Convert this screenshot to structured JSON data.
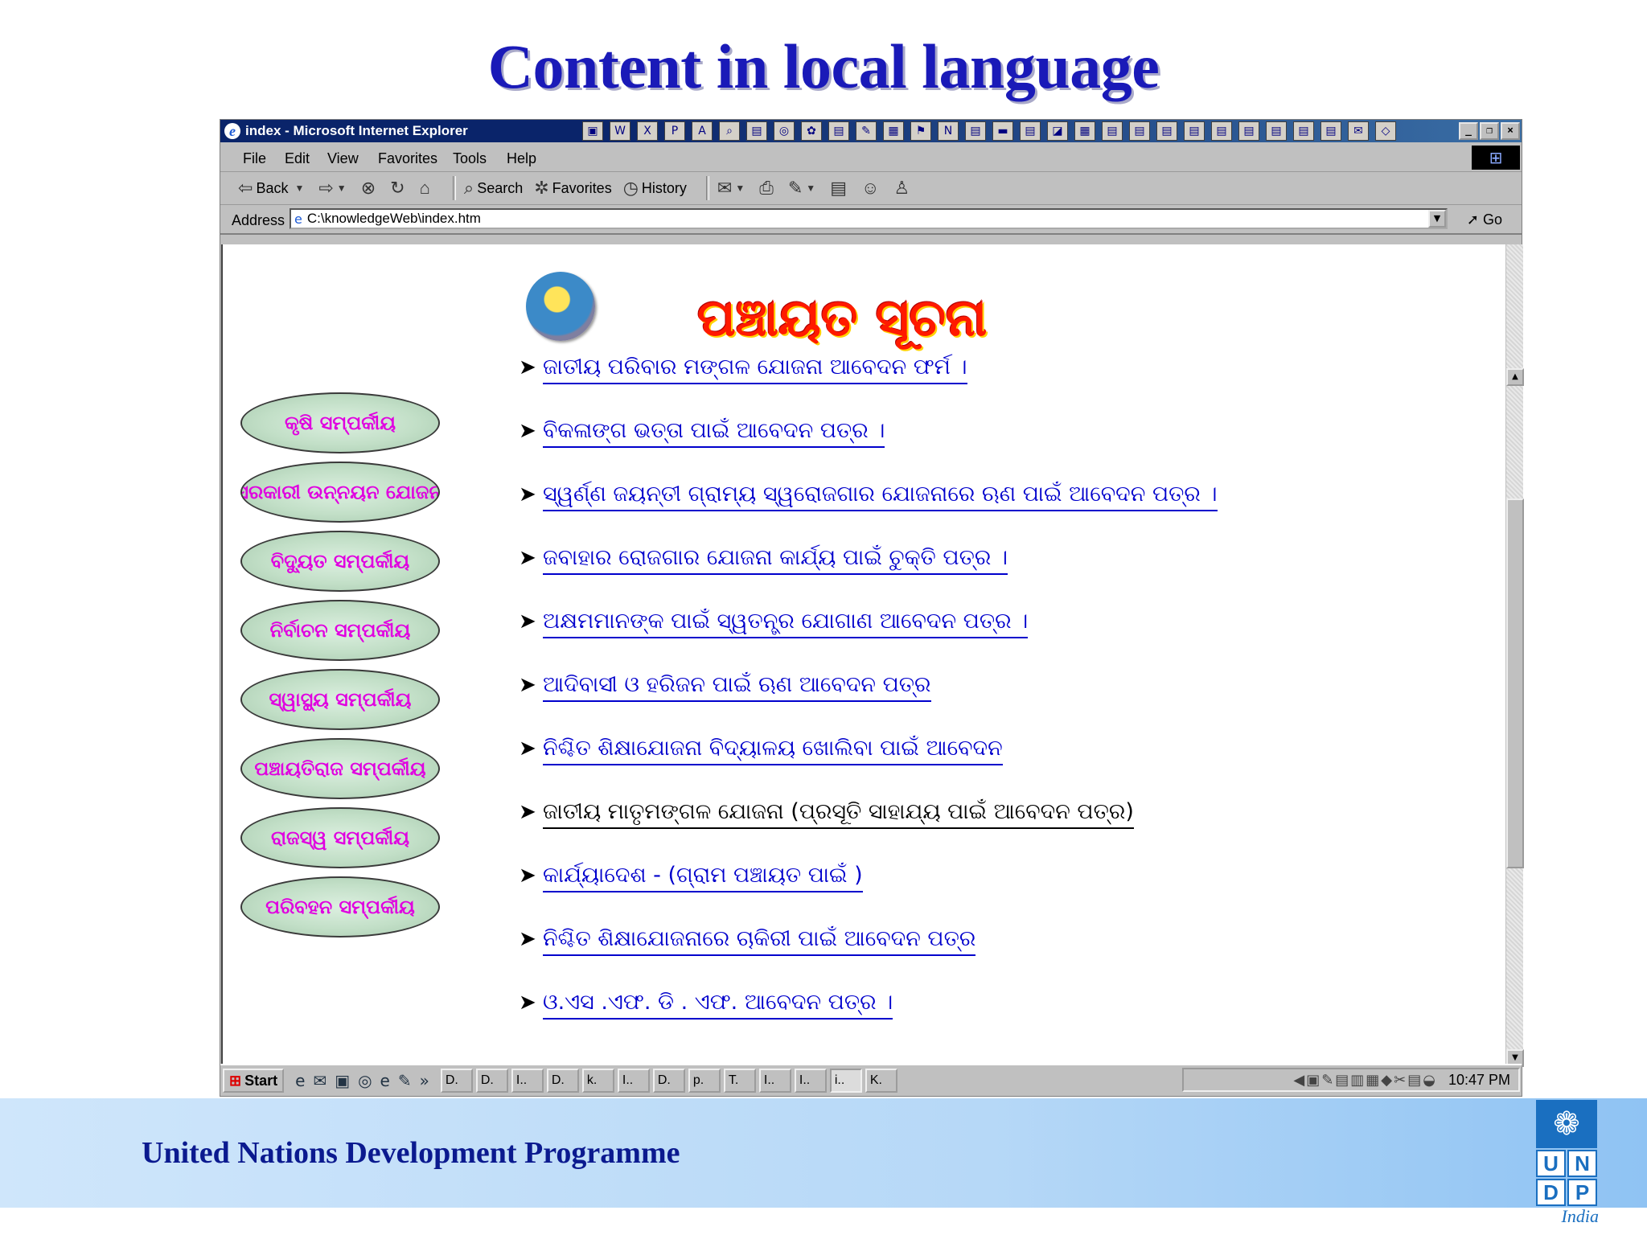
{
  "slide": {
    "title": "Content in local language",
    "footer": "United Nations Development Programme",
    "logo": {
      "cells": [
        "U",
        "N",
        "D",
        "P"
      ],
      "country": "India",
      "emblem": "un-emblem-icon"
    }
  },
  "browser": {
    "title": "index - Microsoft Internet Explorer",
    "menu": [
      "File",
      "Edit",
      "View",
      "Favorites",
      "Tools",
      "Help"
    ],
    "toolbar": {
      "back": "Back",
      "search": "Search",
      "favorites": "Favorites",
      "history": "History"
    },
    "address": {
      "label": "Address",
      "url": "C:\\knowledgeWeb\\index.htm",
      "go": "Go"
    }
  },
  "page": {
    "heading": "ପଞ୍ଚାୟତ ସୂଚନା",
    "side_nav": [
      "କୃଷି ସମ୍ପର୍କୀୟ",
      "ସରକାରୀ ଉନ୍ନୟନ ଯୋଜନା",
      "ବିଦ୍ୟୁତ ସମ୍ପର୍କୀୟ",
      "ନିର୍ବାଚନ ସମ୍ପର୍କୀୟ",
      "ସ୍ୱାସ୍ଥ୍ୟ ସମ୍ପର୍କୀୟ",
      "ପଞ୍ଚାୟତିରାଜ ସମ୍ପର୍କୀୟ",
      "ରାଜସ୍ୱ ସମ୍ପର୍କୀୟ",
      "ପରିବହନ ସମ୍ପର୍କୀୟ"
    ],
    "links": [
      "ଜାତୀୟ ପରିବାର ମଙ୍ଗଳ ଯୋଜନା  ଆବେଦନ ଫର୍ମ  ।",
      "ବିକଳାଙ୍ଗ ଭତ୍ତା ପାଇଁ ଆବେଦନ ପତ୍ର  ।",
      "ସ୍ୱର୍ଣ୍ଣ ଜୟନ୍ତୀ ଗ୍ରାମ୍ୟ ସ୍ୱରୋଜଗାର ଯୋଜନାରେ ଋଣ ପାଇଁ ଆବେଦନ ପତ୍ର  ।",
      "ଜବାହାର ରୋଜଗାର ଯୋଜନା କାର୍ଯ୍ୟ ପାଇଁ ଚୁକ୍ତି ପତ୍ର   ।",
      "ଅକ୍ଷମମାନଙ୍କ ପାଇଁ ସ୍ୱତନ୍ତ୍ର ଯୋଗାଣ ଆବେଦନ ପତ୍ର   ।",
      "ଆଦିବାସୀ ଓ ହରିଜନ ପାଇଁ ଋଣ ଆବେଦନ ପତ୍ର",
      "ନିଶ୍ଚିତ ଶିକ୍ଷାଯୋଜନା ବିଦ୍ୟାଳୟ ଖୋଲିବା ପାଇଁ ଆବେଦନ",
      "ଜାତୀୟ ମାତୃମଙ୍ଗଳ ଯୋଜନା (ପ୍ରସୂତି ସାହାଯ୍ୟ ପାଇଁ ଆବେଦନ ପତ୍ର)",
      "କାର୍ଯ୍ୟାଦେଶ - (ଗ୍ରାମ ପଞ୍ଚାୟତ ପାଇଁ )",
      "ନିଶ୍ଚିତ ଶିକ୍ଷାଯୋଜନାରେ ଚାକିରୀ ପାଇଁ ଆବେଦନ ପତ୍ର",
      "ଓ.ଏସ .ଏଫ. ଡି . ଏଫ. ଆବେଦନ ପତ୍ର  ।"
    ]
  },
  "taskbar": {
    "start": "Start",
    "buttons": [
      "D.",
      "D.",
      "I..",
      "D.",
      "k.",
      "I..",
      "D.",
      "p.",
      "T.",
      "I..",
      "I..",
      "i..",
      "K."
    ],
    "clock": "10:47 PM"
  }
}
